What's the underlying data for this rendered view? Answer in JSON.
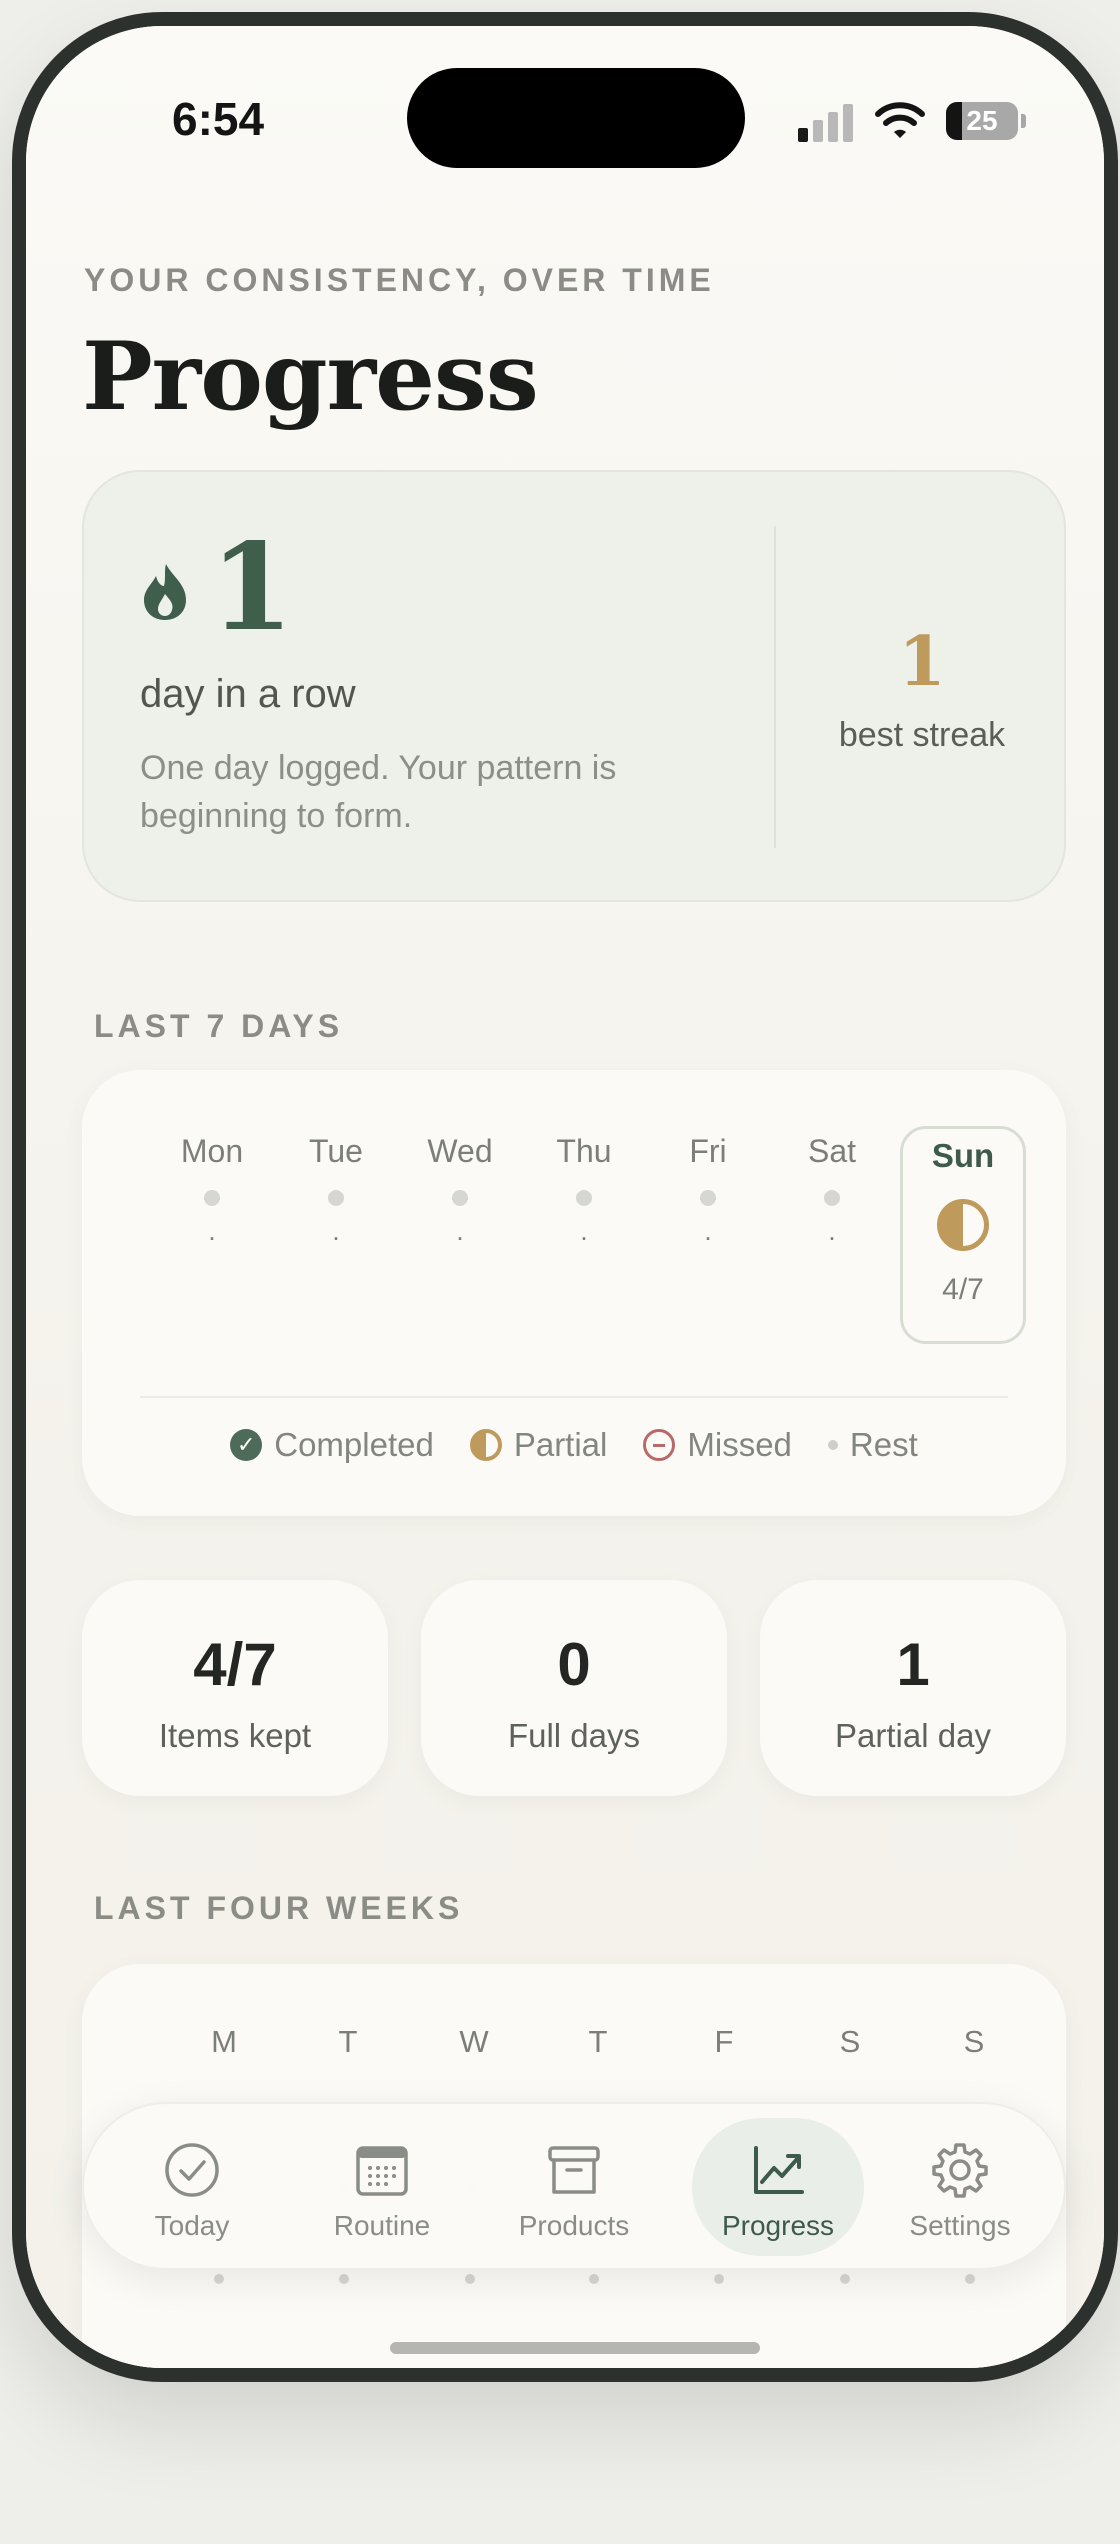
{
  "status_bar": {
    "time": "6:54",
    "battery": "25"
  },
  "header": {
    "eyebrow": "YOUR CONSISTENCY, OVER TIME",
    "title": "Progress"
  },
  "streak": {
    "count": "1",
    "unit": "day in a row",
    "message": "One day logged. Your pattern is beginning to form.",
    "best_value": "1",
    "best_label": "best streak"
  },
  "last7": {
    "label": "LAST 7 DAYS",
    "days": [
      {
        "name": "Mon",
        "value": "."
      },
      {
        "name": "Tue",
        "value": "."
      },
      {
        "name": "Wed",
        "value": "."
      },
      {
        "name": "Thu",
        "value": "."
      },
      {
        "name": "Fri",
        "value": "."
      },
      {
        "name": "Sat",
        "value": "."
      },
      {
        "name": "Sun",
        "value": "4/7",
        "status": "partial"
      }
    ],
    "legend": {
      "completed": "Completed",
      "partial": "Partial",
      "missed": "Missed",
      "rest": "Rest"
    }
  },
  "stats": [
    {
      "value": "4/7",
      "label": "Items kept"
    },
    {
      "value": "0",
      "label": "Full days"
    },
    {
      "value": "1",
      "label": "Partial day"
    }
  ],
  "four_weeks": {
    "label": "LAST FOUR WEEKS",
    "weekdays": [
      "M",
      "T",
      "W",
      "T",
      "F",
      "S",
      "S"
    ]
  },
  "tabs": [
    {
      "label": "Today",
      "icon": "check-circle-icon"
    },
    {
      "label": "Routine",
      "icon": "calendar-icon"
    },
    {
      "label": "Products",
      "icon": "archive-box-icon"
    },
    {
      "label": "Progress",
      "icon": "chart-trend-icon",
      "active": true
    },
    {
      "label": "Settings",
      "icon": "gear-icon"
    }
  ],
  "colors": {
    "accent_green": "#3e5a4a",
    "accent_gold": "#bf9a5d",
    "missed_red": "#b96a68"
  }
}
